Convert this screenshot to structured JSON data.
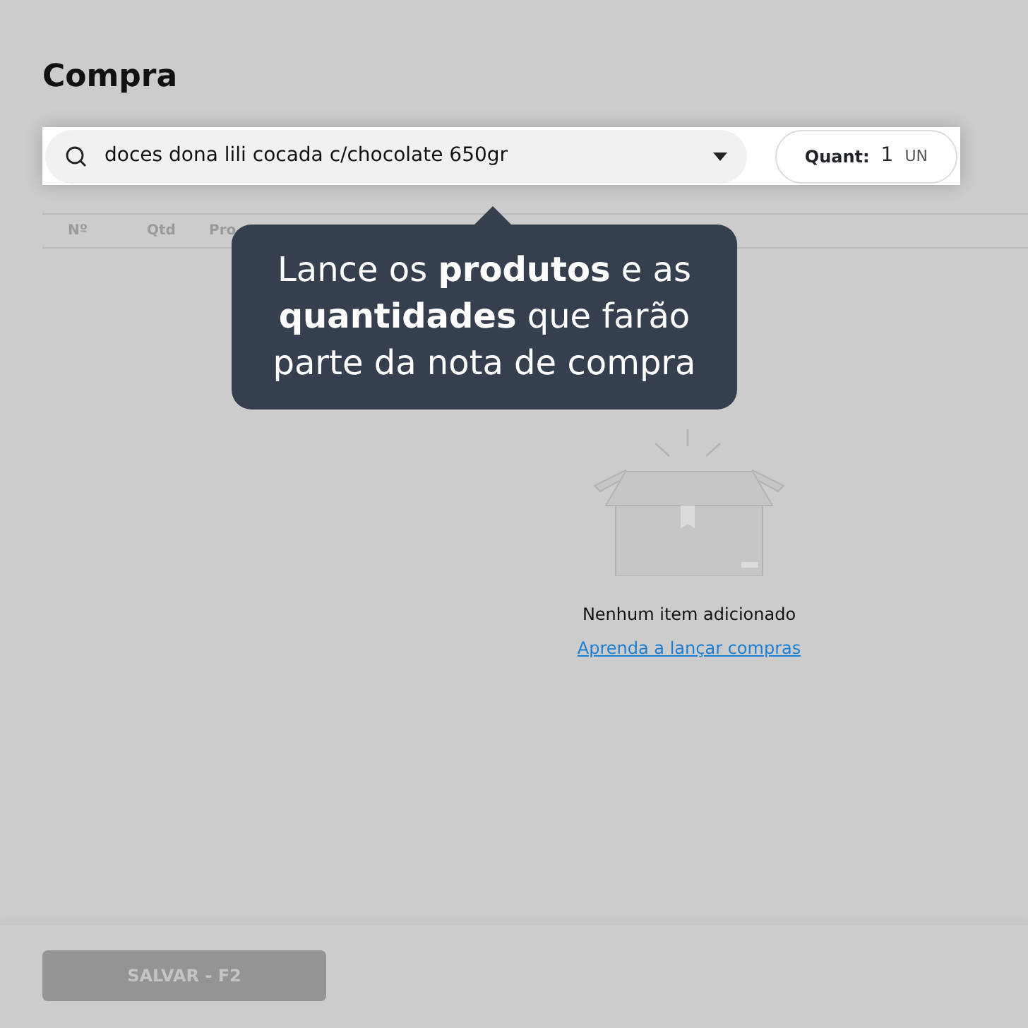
{
  "title": "Compra",
  "search": {
    "value": "doces dona lili cocada c/chocolate 650gr"
  },
  "quantity": {
    "label": "Quant:",
    "value": "1",
    "unit": "UN"
  },
  "table": {
    "columns": [
      "Nº",
      "Qtd",
      "Pro"
    ]
  },
  "tooltip": {
    "text": "Lance os **produtos** e as **quantidades** que farão parte da nota de compra"
  },
  "empty_state": {
    "message": "Nenhum item adicionado",
    "link": "Aprenda a lançar compras"
  },
  "footer": {
    "save_button": {
      "label": "SALVAR - F2",
      "disabled": true
    }
  }
}
